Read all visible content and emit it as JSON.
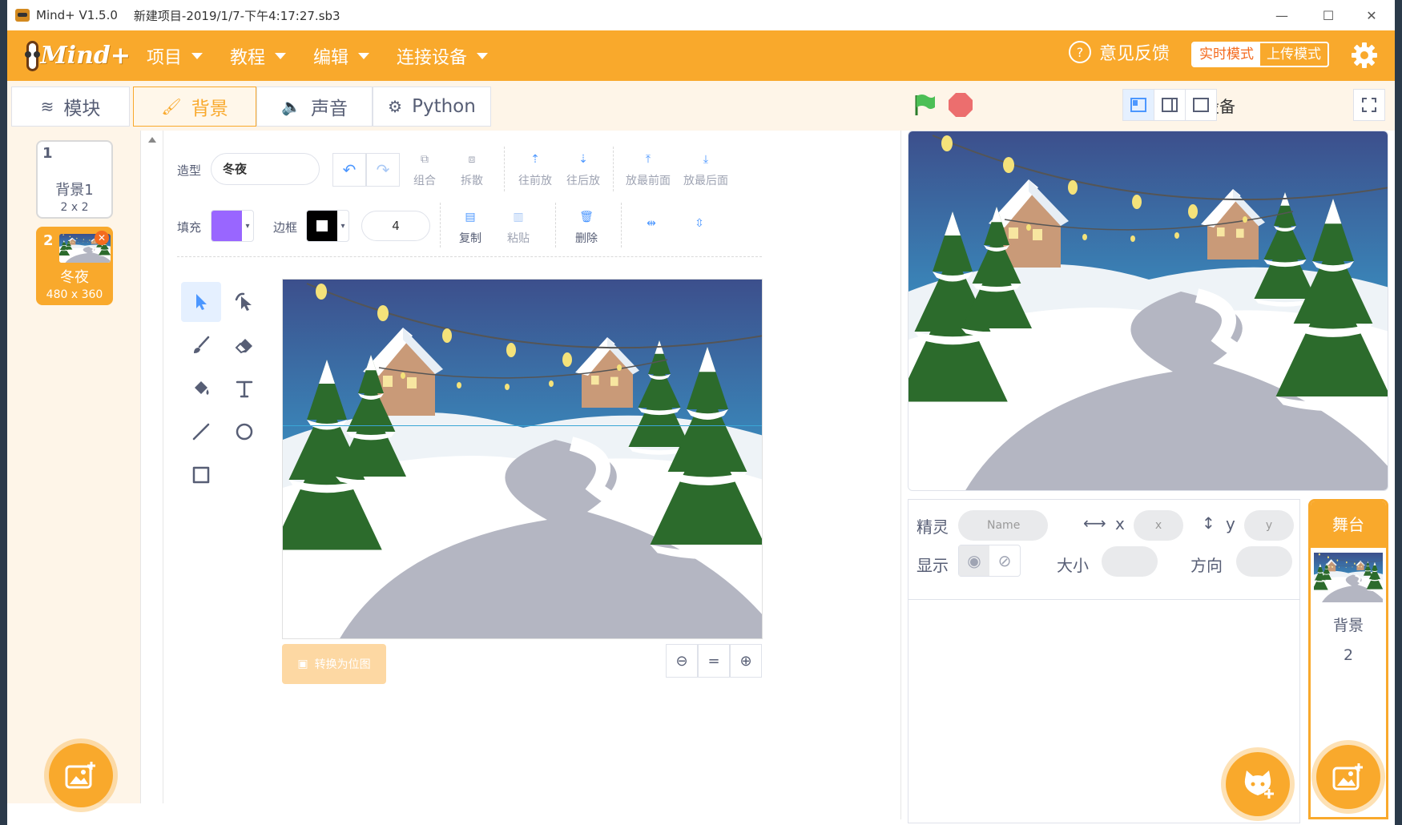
{
  "window": {
    "app_name": "Mind+ V1.5.0",
    "project": "新建项目-2019/1/7-下午4:17:27.sb3",
    "minimize": "—",
    "maximize": "☐",
    "close": "✕"
  },
  "menubar": {
    "logo": "Mind+",
    "items": [
      "项目",
      "教程",
      "编辑",
      "连接设备"
    ],
    "feedback": "意见反馈",
    "mode_live": "实时模式",
    "mode_upload": "上传模式"
  },
  "tabs": [
    {
      "label": "模块",
      "icon": "blocks-icon"
    },
    {
      "label": "背景",
      "icon": "brush-icon"
    },
    {
      "label": "声音",
      "icon": "sound-icon"
    },
    {
      "label": "Python",
      "icon": "python-icon"
    }
  ],
  "stage_controls": {
    "connection": "未连接设备"
  },
  "costumes": [
    {
      "num": "1",
      "name": "背景1",
      "size": "2 x 2"
    },
    {
      "num": "2",
      "name": "冬夜",
      "size": "480 x 360"
    }
  ],
  "editor": {
    "costume_label": "造型",
    "costume_name": "冬夜",
    "fill_label": "填充",
    "fill_color": "#9966ff",
    "outline_label": "边框",
    "outline_color": "#000000",
    "outline_width": "4",
    "tools_row1": [
      "组合",
      "拆散",
      "往前放",
      "往后放",
      "放最前面",
      "放最后面"
    ],
    "tools_row2": [
      "复制",
      "粘贴",
      "删除"
    ],
    "convert_bitmap": "转换为位图",
    "zoom_reset": "="
  },
  "sprite_info": {
    "sprite_label": "精灵",
    "name_placeholder": "Name",
    "x_label": "x",
    "x_placeholder": "x",
    "y_label": "y",
    "y_placeholder": "y",
    "show_label": "显示",
    "size_label": "大小",
    "direction_label": "方向"
  },
  "stage_panel": {
    "header": "舞台",
    "label": "背景",
    "count": "2"
  },
  "colors": {
    "accent": "#f9a92c",
    "selected_tool": "#e5f0ff",
    "stop": "#ec6e6e"
  }
}
